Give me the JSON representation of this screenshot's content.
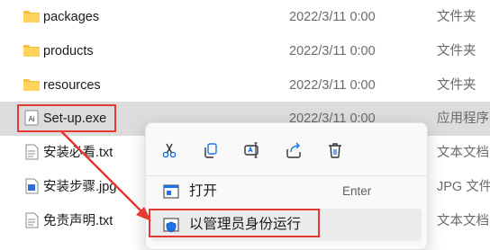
{
  "files": [
    {
      "name": "packages",
      "date": "2022/3/11 0:00",
      "type": "文件夹",
      "icon": "folder-icon"
    },
    {
      "name": "products",
      "date": "2022/3/11 0:00",
      "type": "文件夹",
      "icon": "folder-icon"
    },
    {
      "name": "resources",
      "date": "2022/3/11 0:00",
      "type": "文件夹",
      "icon": "folder-icon"
    },
    {
      "name": "Set-up.exe",
      "date": "2022/3/11 0:00",
      "type": "应用程序",
      "icon": "exe-icon",
      "selected": true
    },
    {
      "name": "安装必看.txt",
      "date": "",
      "type": "文本文档",
      "icon": "text-file-icon"
    },
    {
      "name": "安装步骤.jpg",
      "date": "",
      "type": "JPG 文件",
      "icon": "image-file-icon"
    },
    {
      "name": "免责声明.txt",
      "date": "",
      "type": "文本文档",
      "icon": "text-file-icon"
    }
  ],
  "context_menu": {
    "quick_actions": [
      "cut-icon",
      "copy-icon",
      "rename-icon",
      "share-icon",
      "delete-icon"
    ],
    "items": [
      {
        "label": "打开",
        "shortcut": "Enter",
        "icon": "open-app-icon"
      },
      {
        "label": "以管理员身份运行",
        "shortcut": "",
        "icon": "admin-shield-icon"
      }
    ]
  },
  "colors": {
    "selection": "#dcdcdc",
    "annotation": "#e53935",
    "folder": "#f4c042",
    "shield_accent": "#1a73e8"
  }
}
